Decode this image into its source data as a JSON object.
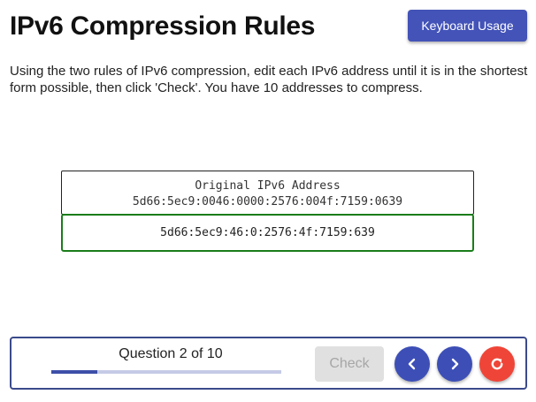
{
  "header": {
    "title": "IPv6 Compression Rules",
    "keyboard_button": "Keyboard Usage"
  },
  "instructions": "Using the two rules of IPv6 compression, edit each IPv6 address until it is in the shortest form possible, then click 'Check'. You have 10 addresses to compress.",
  "original": {
    "label": "Original IPv6 Address",
    "address": "5d66:5ec9:0046:0000:2576:004f:7159:0639"
  },
  "answer": {
    "value": "5d66:5ec9:46:0:2576:4f:7159:639",
    "border_color": "#1a7d1a"
  },
  "footer": {
    "question_label": "Question 2 of 10",
    "progress_fraction": 0.2,
    "check_label": "Check",
    "icons": {
      "prev": "chevron-left-icon",
      "next": "chevron-right-icon",
      "reset": "reset-icon"
    }
  },
  "colors": {
    "accent": "#3d4fb6",
    "reset": "#ef4538",
    "correct": "#1a7d1a",
    "disabled": "#e0e0e0"
  }
}
